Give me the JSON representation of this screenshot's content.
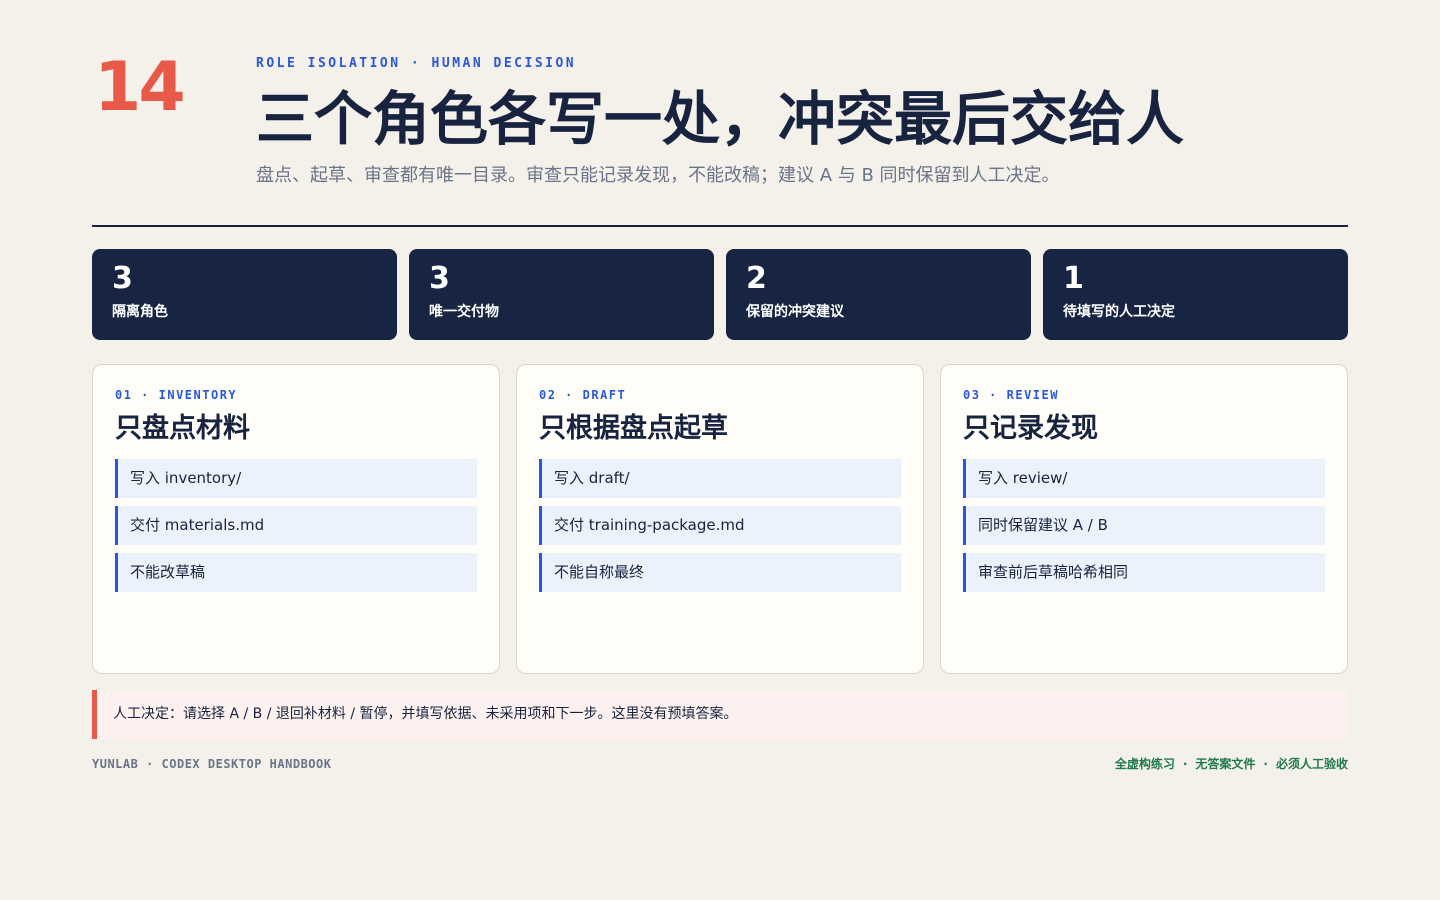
{
  "page_number": "14",
  "header": {
    "kicker": "ROLE ISOLATION · HUMAN DECISION",
    "title": "三个角色各写一处，冲突最后交给人",
    "subtitle": "盘点、起草、审查都有唯一目录。审查只能记录发现，不能改稿；建议 A 与 B 同时保留到人工决定。"
  },
  "stats": [
    {
      "value": "3",
      "label": "隔离角色"
    },
    {
      "value": "3",
      "label": "唯一交付物"
    },
    {
      "value": "2",
      "label": "保留的冲突建议"
    },
    {
      "value": "1",
      "label": "待填写的人工决定"
    }
  ],
  "cards": [
    {
      "kicker": "01 · INVENTORY",
      "title": "只盘点材料",
      "items": [
        "写入 inventory/",
        "交付 materials.md",
        "不能改草稿"
      ]
    },
    {
      "kicker": "02 · DRAFT",
      "title": "只根据盘点起草",
      "items": [
        "写入 draft/",
        "交付 training-package.md",
        "不能自称最终"
      ]
    },
    {
      "kicker": "03 · REVIEW",
      "title": "只记录发现",
      "items": [
        "写入 review/",
        "同时保留建议 A / B",
        "审查前后草稿哈希相同"
      ]
    }
  ],
  "decision": "人工决定：请选择 A / B / 退回补材料 / 暂停，并填写依据、未采用项和下一步。这里没有预填答案。",
  "footer": {
    "left": "YUNLAB · CODEX DESKTOP HANDBOOK",
    "right": [
      "全虚构练习",
      "无答案文件",
      "必须人工验收"
    ],
    "separator": "·"
  },
  "colors": {
    "background": "#f4f0ea",
    "navy": "#172542",
    "accent_red": "#e8594a",
    "accent_blue": "#2b58d6",
    "green": "#1f7a4a"
  }
}
